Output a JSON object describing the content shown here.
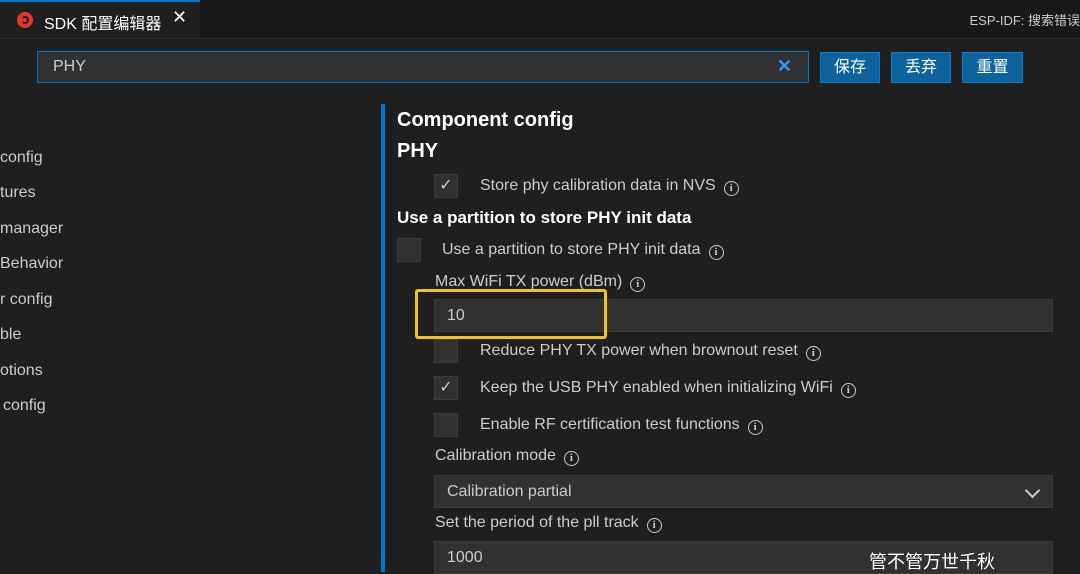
{
  "tab": {
    "title": "SDK 配置编辑器",
    "close": "✕"
  },
  "status_right": "ESP-IDF: 搜索错误",
  "search": {
    "value": "PHY",
    "clear": "✕"
  },
  "buttons": {
    "save": "保存",
    "discard": "丢弃",
    "reset": "重置"
  },
  "sidebar": {
    "items": [
      "config",
      "tures",
      "manager",
      "Behavior",
      "r config",
      "ble",
      "otions",
      " config"
    ]
  },
  "main": {
    "title": "Component config",
    "section": "PHY",
    "store_calib": {
      "label": "Store phy calibration data in NVS",
      "checked": true
    },
    "partition_heading": "Use a partition to store PHY init data",
    "use_partition": {
      "label": "Use a partition to store PHY init data",
      "checked": false
    },
    "max_tx_power": {
      "label": "Max WiFi TX power (dBm)",
      "value": "10"
    },
    "reduce_tx_power": {
      "label": "Reduce PHY TX power when brownout reset",
      "checked": false
    },
    "keep_usb_phy": {
      "label": "Keep the USB PHY enabled when initializing WiFi",
      "checked": true
    },
    "rf_cert": {
      "label": "Enable RF certification test functions",
      "checked": false
    },
    "calibration_mode": {
      "label": "Calibration mode",
      "value": "Calibration partial"
    },
    "pll_track": {
      "label": "Set the period of the pll track",
      "value": "1000"
    }
  },
  "info_glyph": "i",
  "check_glyph": "✓",
  "watermark": "管不管万世千秋",
  "colors": {
    "accent": "#0078d4",
    "highlight": "#f0c419",
    "button": "#0e639c"
  }
}
